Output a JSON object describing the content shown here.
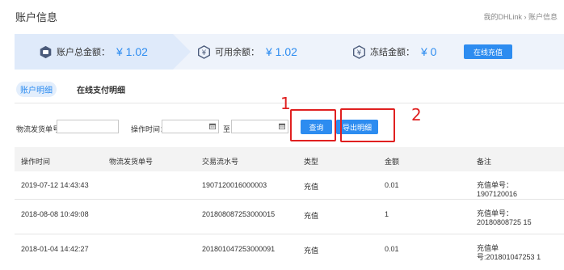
{
  "header": {
    "title": "账户信息",
    "breadcrumb": "我的DHLink › 账户信息"
  },
  "summary": {
    "total_label": "账户总金额：",
    "total_value": "¥ 1.02",
    "available_label": "可用余额：",
    "available_value": "¥ 1.02",
    "frozen_label": "冻结金额：",
    "frozen_value": "¥ 0",
    "recharge_button": "在线充值"
  },
  "tabs": [
    {
      "label": "账户明细",
      "active": true
    },
    {
      "label": "在线支付明细",
      "active": false
    }
  ],
  "filters": {
    "logistics_label": "物流发货单号",
    "logistics_value": "",
    "time_label": "操作时间：",
    "to_label": "至",
    "start_date": "",
    "end_date": "",
    "query_button": "查询",
    "export_button": "导出明细"
  },
  "annotations": {
    "one": "1",
    "two": "2"
  },
  "table": {
    "columns": [
      "操作时间",
      "物流发货单号",
      "交易流水号",
      "类型",
      "金额",
      "备注"
    ],
    "rows": [
      {
        "time": "2019-07-12 14:43:43",
        "logistics": "",
        "serial": "1907120016000003",
        "type": "充值",
        "amount": "0.01",
        "note": "充值单号：1907120016"
      },
      {
        "time": "2018-08-08 10:49:08",
        "logistics": "",
        "serial": "201808087253000015",
        "type": "充值",
        "amount": "1",
        "note": "充值单号：20180808725 15"
      },
      {
        "time": "2018-01-04 14:42:27",
        "logistics": "",
        "serial": "201801047253000091",
        "type": "充值",
        "amount": "0.01",
        "note": "充值单号:201801047253 1"
      }
    ]
  },
  "colors": {
    "accent": "#2d8cf0",
    "highlight": "#e02020",
    "summary_bg": "#eef3fb"
  }
}
